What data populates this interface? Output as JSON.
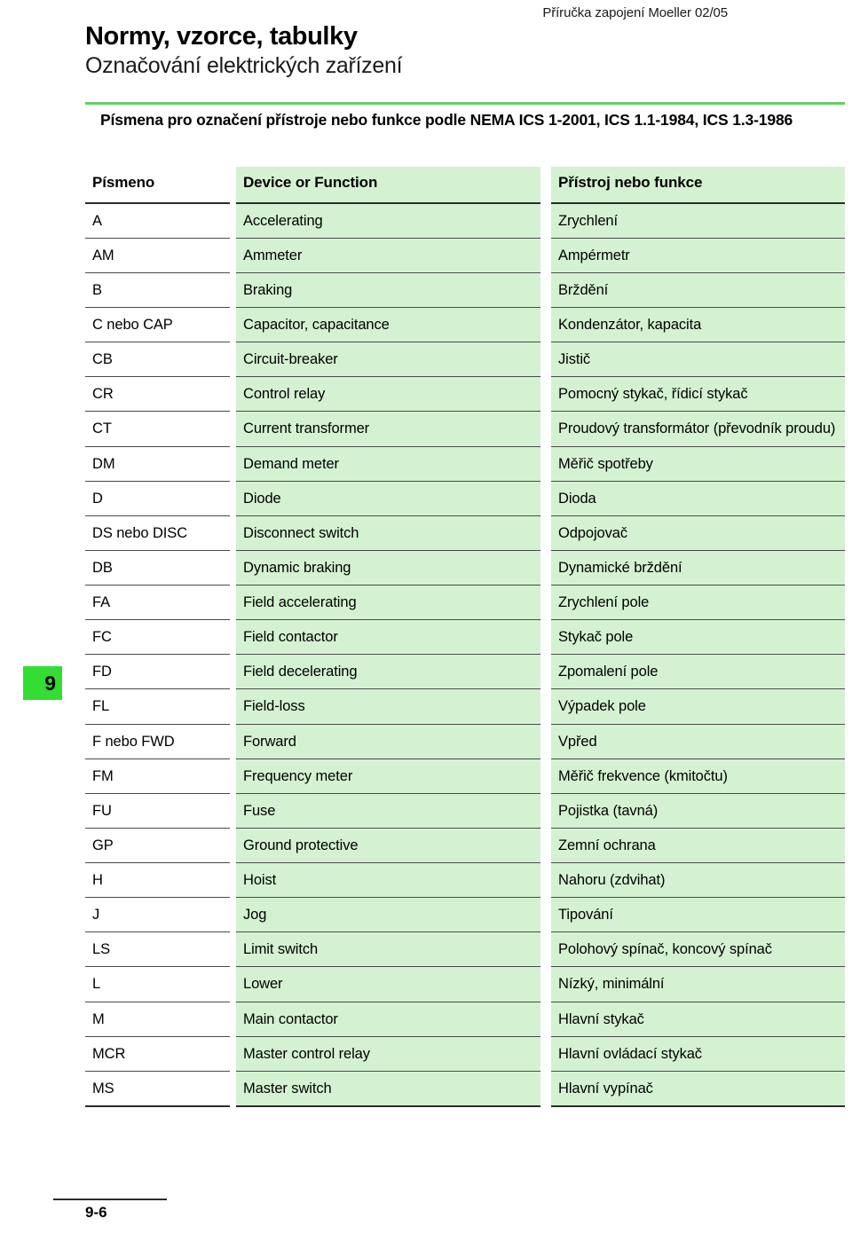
{
  "running_head": "Příručka zapojení Moeller 02/05",
  "page": {
    "title": "Normy, vzorce, tabulky",
    "subtitle": "Označování elektrických zařízení",
    "section_heading": "Písmena pro označení přístroje nebo funkce podle NEMA ICS 1-2001, ICS 1.1-1984, ICS 1.3-1986",
    "tab_number": "9",
    "footer_page_number": "9-6"
  },
  "colors": {
    "cell_tint": "#d4f2d2",
    "accent_rule": "#5ed25e",
    "tab_green": "#33dd33",
    "rule_dark": "#2b2b2b",
    "rule_light": "#4a4a4a"
  },
  "table": {
    "columns": [
      "Písmeno",
      "Device or Function",
      "Přístroj nebo funkce"
    ],
    "rows": [
      {
        "letter": "A",
        "device": "Accelerating",
        "pristroj": "Zrychlení"
      },
      {
        "letter": "AM",
        "device": "Ammeter",
        "pristroj": "Ampérmetr"
      },
      {
        "letter": "B",
        "device": "Braking",
        "pristroj": "Brždění"
      },
      {
        "letter": "C nebo CAP",
        "device": "Capacitor, capacitance",
        "pristroj": "Kondenzátor, kapacita"
      },
      {
        "letter": "CB",
        "device": "Circuit-breaker",
        "pristroj": "Jistič"
      },
      {
        "letter": "CR",
        "device": "Control relay",
        "pristroj": "Pomocný stykač, řídicí stykač"
      },
      {
        "letter": "CT",
        "device": "Current transformer",
        "pristroj": "Proudový transformátor (převodník proudu)"
      },
      {
        "letter": "DM",
        "device": "Demand meter",
        "pristroj": "Měřič spotřeby"
      },
      {
        "letter": "D",
        "device": "Diode",
        "pristroj": "Dioda"
      },
      {
        "letter": "DS nebo DISC",
        "device": "Disconnect switch",
        "pristroj": "Odpojovač"
      },
      {
        "letter": "DB",
        "device": "Dynamic braking",
        "pristroj": "Dynamické brždění"
      },
      {
        "letter": "FA",
        "device": "Field accelerating",
        "pristroj": "Zrychlení pole"
      },
      {
        "letter": "FC",
        "device": "Field contactor",
        "pristroj": "Stykač pole"
      },
      {
        "letter": "FD",
        "device": "Field decelerating",
        "pristroj": "Zpomalení pole"
      },
      {
        "letter": "FL",
        "device": "Field-loss",
        "pristroj": "Výpadek pole"
      },
      {
        "letter": "F nebo FWD",
        "device": "Forward",
        "pristroj": "Vpřed"
      },
      {
        "letter": "FM",
        "device": "Frequency meter",
        "pristroj": "Měřič frekvence (kmitočtu)"
      },
      {
        "letter": "FU",
        "device": "Fuse",
        "pristroj": "Pojistka (tavná)"
      },
      {
        "letter": "GP",
        "device": "Ground protective",
        "pristroj": "Zemní ochrana"
      },
      {
        "letter": "H",
        "device": "Hoist",
        "pristroj": "Nahoru (zdvihat)"
      },
      {
        "letter": "J",
        "device": "Jog",
        "pristroj": "Tipování"
      },
      {
        "letter": "LS",
        "device": "Limit switch",
        "pristroj": "Polohový spínač, koncový spínač"
      },
      {
        "letter": "L",
        "device": "Lower",
        "pristroj": "Nízký, minimální"
      },
      {
        "letter": "M",
        "device": "Main contactor",
        "pristroj": "Hlavní stykač"
      },
      {
        "letter": "MCR",
        "device": "Master control relay",
        "pristroj": "Hlavní ovládací stykač"
      },
      {
        "letter": "MS",
        "device": "Master switch",
        "pristroj": "Hlavní vypínač"
      }
    ]
  }
}
